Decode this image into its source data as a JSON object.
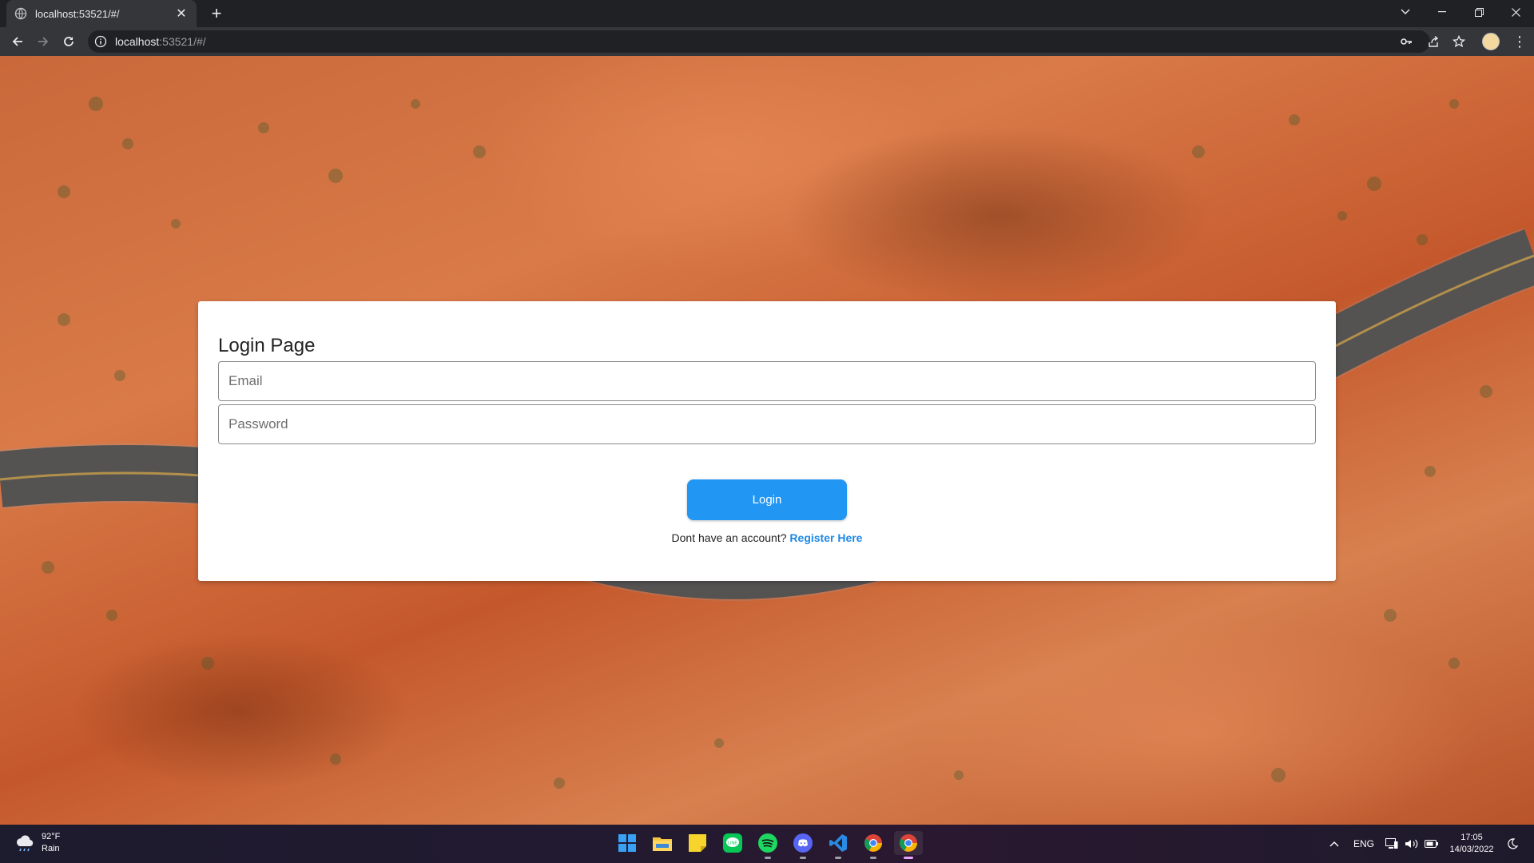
{
  "browser": {
    "tab_title": "localhost:53521/#/",
    "new_tab_label": "+",
    "url_host": "localhost",
    "url_rest": ":53521/#/"
  },
  "page": {
    "title": "Login Page",
    "email_placeholder": "Email",
    "password_placeholder": "Password",
    "login_button": "Login",
    "register_prompt": "Dont have an account?",
    "register_link": "Register Here",
    "accent_color": "#2196f3"
  },
  "taskbar": {
    "weather_temp": "92°F",
    "weather_desc": "Rain",
    "language": "ENG",
    "time": "17:05",
    "date": "14/03/2022",
    "pinned_apps": [
      "start-icon",
      "file-explorer-icon",
      "sticky-notes-icon",
      "line-icon",
      "spotify-icon",
      "discord-icon",
      "vscode-icon",
      "chrome-icon",
      "chrome-active-icon"
    ]
  }
}
